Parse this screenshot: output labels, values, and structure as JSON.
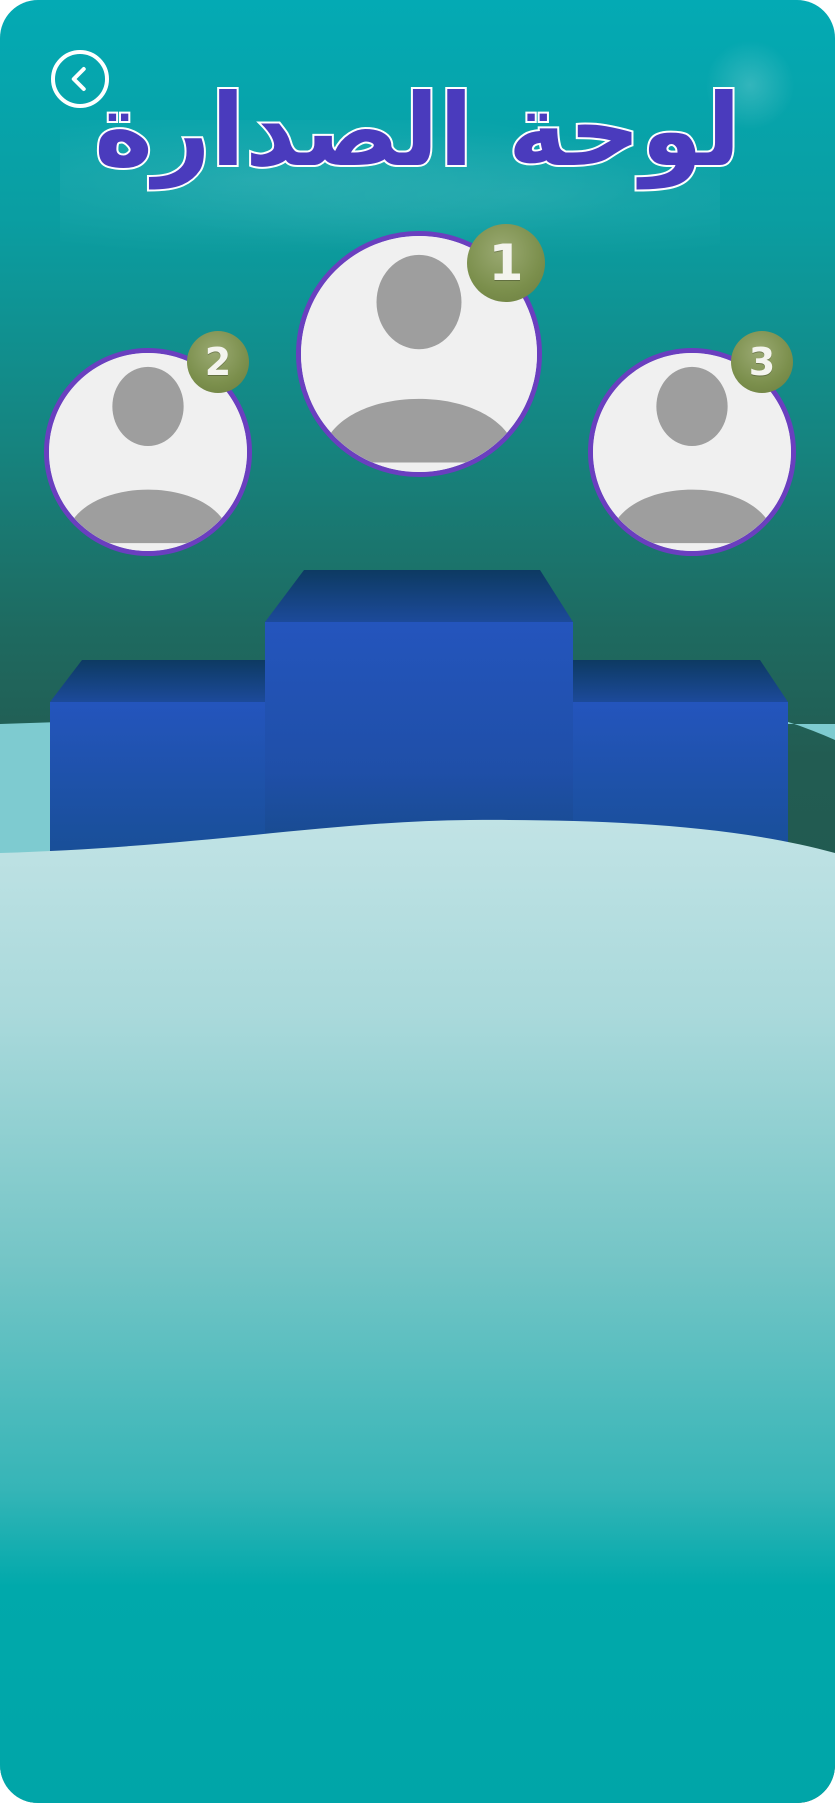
{
  "header": {
    "title": "لوحة الصدارة",
    "back_icon": "chevron-left-icon"
  },
  "podium": {
    "first": {
      "rank": "1",
      "avatar_icon": "user-placeholder-icon"
    },
    "second": {
      "rank": "2",
      "avatar_icon": "user-placeholder-icon"
    },
    "third": {
      "rank": "3",
      "avatar_icon": "user-placeholder-icon"
    }
  },
  "colors": {
    "title": "#4a3bbd",
    "avatar_border": "#6a3fbf",
    "badge": "#7b8f4c",
    "podium": "#2456b8",
    "background_top": "#03aab4",
    "background_mid": "#215a50"
  }
}
